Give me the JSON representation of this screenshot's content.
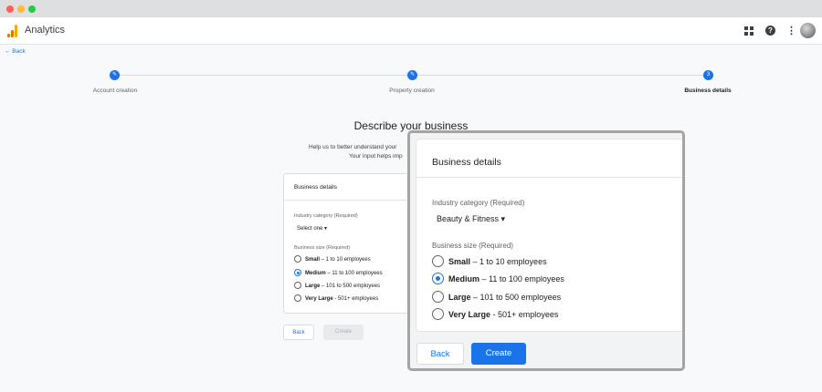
{
  "app": {
    "title": "Analytics",
    "back_label": "← Back"
  },
  "header_icons": [
    "apps-grid-icon",
    "help-icon",
    "more-vert-icon",
    "avatar"
  ],
  "stepper": [
    {
      "number": "",
      "label": "Account creation",
      "state": "complete",
      "icon": "pencil-icon"
    },
    {
      "number": "",
      "label": "Property creation",
      "state": "complete",
      "icon": "pencil-icon"
    },
    {
      "number": "3",
      "label": "Business details",
      "state": "active"
    }
  ],
  "page": {
    "title": "Describe your business",
    "subtitle_line1": "Help us to better understand your",
    "subtitle_line2": "Your input helps imp"
  },
  "card": {
    "title": "Business details",
    "industry_label": "Industry category (Required)",
    "industry_placeholder": "Select one ▾",
    "size_label": "Business size (Required)",
    "sizes": [
      {
        "bold": "Small",
        "rest": " – 1 to 10 employees"
      },
      {
        "bold": "Medium",
        "rest": " – 11 to 100 employees"
      },
      {
        "bold": "Large",
        "rest": " – 101 to 500 employees"
      },
      {
        "bold": "Very Large",
        "rest": " - 501+ employees"
      }
    ],
    "selected_size": "Medium"
  },
  "zoom_card": {
    "title": "Business details",
    "industry_label": "Industry category (Required)",
    "industry_value": "Beauty & Fitness ▾",
    "size_label": "Business size (Required)"
  },
  "buttons": {
    "back": "Back",
    "create": "Create",
    "create_bg_disabled": true
  },
  "colors": {
    "accent": "#1a73e8",
    "logo_orange": "#f9ab00",
    "logo_dark": "#e37400"
  }
}
